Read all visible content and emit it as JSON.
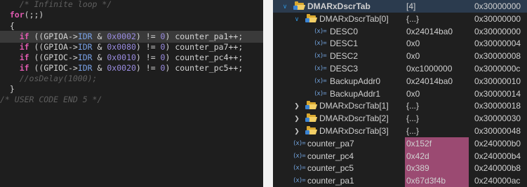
{
  "editor": {
    "lines": [
      {
        "t": [
          {
            "c": "cm",
            "v": "    /* Infinite loop */"
          }
        ]
      },
      {
        "t": [
          {
            "c": "pl",
            "v": "  "
          },
          {
            "c": "kw",
            "v": "for"
          },
          {
            "c": "pl",
            "v": "(;;)"
          }
        ]
      },
      {
        "t": [
          {
            "c": "pl",
            "v": "  {"
          }
        ]
      },
      {
        "hl": true,
        "t": [
          {
            "c": "pl",
            "v": "    "
          },
          {
            "c": "kw",
            "v": "if"
          },
          {
            "c": "pl",
            "v": " (("
          },
          {
            "c": "pl",
            "v": "GPIOA->"
          },
          {
            "c": "id",
            "v": "IDR"
          },
          {
            "c": "pl",
            "v": " & "
          },
          {
            "c": "num",
            "v": "0x0002"
          },
          {
            "c": "pl",
            "v": ") != "
          },
          {
            "c": "num",
            "v": "0"
          },
          {
            "c": "pl",
            "v": ") counter_pa1++;"
          }
        ]
      },
      {
        "t": [
          {
            "c": "pl",
            "v": "    "
          },
          {
            "c": "kw",
            "v": "if"
          },
          {
            "c": "pl",
            "v": " (("
          },
          {
            "c": "pl",
            "v": "GPIOA->"
          },
          {
            "c": "id",
            "v": "IDR"
          },
          {
            "c": "pl",
            "v": " & "
          },
          {
            "c": "num",
            "v": "0x0080"
          },
          {
            "c": "pl",
            "v": ") != "
          },
          {
            "c": "num",
            "v": "0"
          },
          {
            "c": "pl",
            "v": ") counter_pa7++;"
          }
        ]
      },
      {
        "t": [
          {
            "c": "pl",
            "v": "    "
          },
          {
            "c": "kw",
            "v": "if"
          },
          {
            "c": "pl",
            "v": " (("
          },
          {
            "c": "pl",
            "v": "GPIOC->"
          },
          {
            "c": "id",
            "v": "IDR"
          },
          {
            "c": "pl",
            "v": " & "
          },
          {
            "c": "num",
            "v": "0x0010"
          },
          {
            "c": "pl",
            "v": ") != "
          },
          {
            "c": "num",
            "v": "0"
          },
          {
            "c": "pl",
            "v": ") counter_pc4++;"
          }
        ]
      },
      {
        "t": [
          {
            "c": "pl",
            "v": "    "
          },
          {
            "c": "kw",
            "v": "if"
          },
          {
            "c": "pl",
            "v": " (("
          },
          {
            "c": "pl",
            "v": "GPIOC->"
          },
          {
            "c": "id",
            "v": "IDR"
          },
          {
            "c": "pl",
            "v": " & "
          },
          {
            "c": "num",
            "v": "0x0020"
          },
          {
            "c": "pl",
            "v": ") != "
          },
          {
            "c": "num",
            "v": "0"
          },
          {
            "c": "pl",
            "v": ") counter_pc5++;"
          }
        ]
      },
      {
        "t": [
          {
            "c": "cm",
            "v": "    //osDelay(1000);"
          }
        ]
      },
      {
        "t": [
          {
            "c": "pl",
            "v": "  }"
          }
        ]
      },
      {
        "t": [
          {
            "c": "cm",
            "v": "/* USER CODE END 5 */"
          }
        ]
      }
    ]
  },
  "variables": [
    {
      "indent": 0,
      "twisty": "open",
      "icon": "folder",
      "name": "DMARxDscrTab",
      "value": "[4]",
      "address": "0x30000000",
      "selected": true,
      "bold": true
    },
    {
      "indent": 1,
      "twisty": "open",
      "icon": "folder",
      "name": "DMARxDscrTab[0]",
      "value": "{...}",
      "address": "0x30000000"
    },
    {
      "indent": 2,
      "twisty": "",
      "icon": "var",
      "name": "DESC0",
      "value": "0x24014ba0",
      "address": "0x30000000"
    },
    {
      "indent": 2,
      "twisty": "",
      "icon": "var",
      "name": "DESC1",
      "value": "0x0",
      "address": "0x30000004"
    },
    {
      "indent": 2,
      "twisty": "",
      "icon": "var",
      "name": "DESC2",
      "value": "0x0",
      "address": "0x30000008"
    },
    {
      "indent": 2,
      "twisty": "",
      "icon": "var",
      "name": "DESC3",
      "value": "0xc1000000",
      "address": "0x3000000c"
    },
    {
      "indent": 2,
      "twisty": "",
      "icon": "var",
      "name": "BackupAddr0",
      "value": "0x24014ba0",
      "address": "0x30000010"
    },
    {
      "indent": 2,
      "twisty": "",
      "icon": "var",
      "name": "BackupAddr1",
      "value": "0x0",
      "address": "0x30000014"
    },
    {
      "indent": 1,
      "twisty": "closed",
      "icon": "folder",
      "name": "DMARxDscrTab[1]",
      "value": "{...}",
      "address": "0x30000018"
    },
    {
      "indent": 1,
      "twisty": "closed",
      "icon": "folder",
      "name": "DMARxDscrTab[2]",
      "value": "{...}",
      "address": "0x30000030"
    },
    {
      "indent": 1,
      "twisty": "closed",
      "icon": "folder",
      "name": "DMARxDscrTab[3]",
      "value": "{...}",
      "address": "0x30000048"
    },
    {
      "indent": 0,
      "twisty": "",
      "icon": "var",
      "name": "counter_pa7",
      "value": "0x152f",
      "address": "0x240000b0",
      "changed": true
    },
    {
      "indent": 0,
      "twisty": "",
      "icon": "var",
      "name": "counter_pc4",
      "value": "0x42d",
      "address": "0x240000b4",
      "changed": true
    },
    {
      "indent": 0,
      "twisty": "",
      "icon": "var",
      "name": "counter_pc5",
      "value": "0x389",
      "address": "0x240000b8",
      "changed": true
    },
    {
      "indent": 0,
      "twisty": "",
      "icon": "var",
      "name": "counter_pa1",
      "value": "0x67d3f4b",
      "address": "0x240000ac",
      "changed": true
    }
  ],
  "symbols": {
    "twisty_open": "∨",
    "twisty_closed": "❯",
    "var_icon": "(x)="
  },
  "colors": {
    "changed_value_bg": "#9b4a72",
    "selected_row_bg": "#2b3b4e",
    "keyword": "#e05ab0",
    "comment": "#5f5f5f"
  }
}
